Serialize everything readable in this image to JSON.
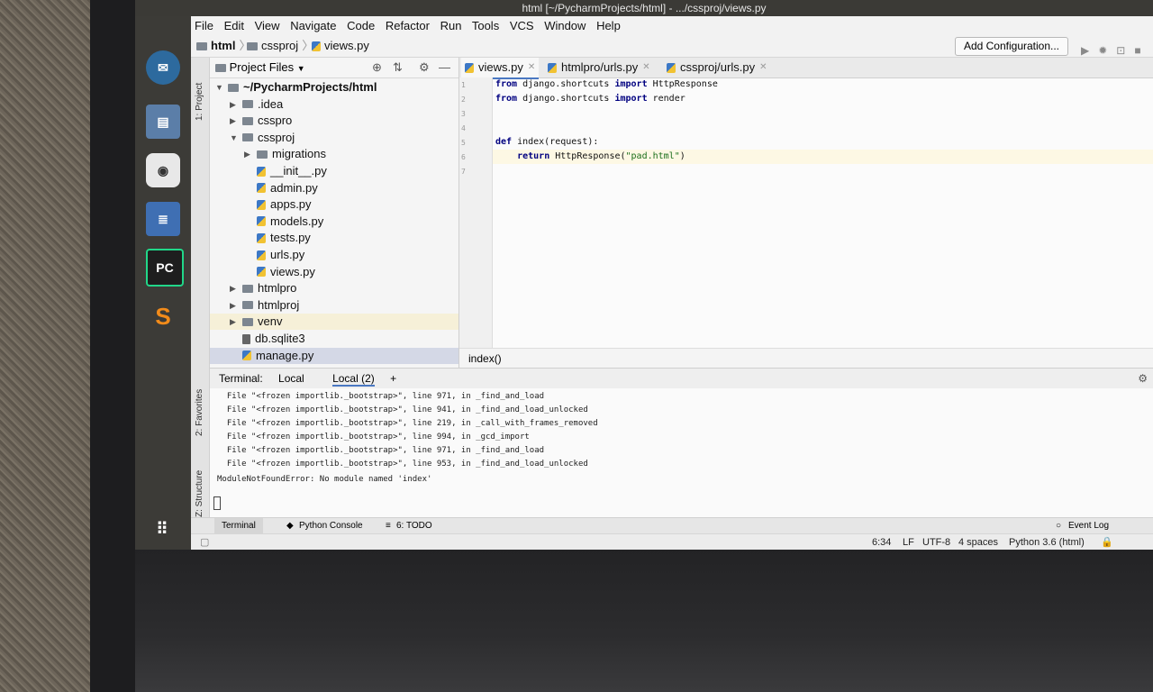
{
  "window": {
    "title": "html [~/PycharmProjects/html] - .../cssproj/views.py"
  },
  "menu": [
    "File",
    "Edit",
    "View",
    "Navigate",
    "Code",
    "Refactor",
    "Run",
    "Tools",
    "VCS",
    "Window",
    "Help"
  ],
  "breadcrumb": {
    "root": "html",
    "folder": "cssproj",
    "file": "views.py"
  },
  "toolbar": {
    "add_configuration": "Add Configuration..."
  },
  "side_tools": {
    "project": "1: Project",
    "favorites": "2: Favorites",
    "structure": "Z: Structure"
  },
  "project_panel": {
    "title": "Project Files",
    "tree": [
      {
        "label": "~/PycharmProjects/html",
        "kind": "folder",
        "depth": 0,
        "expanded": true
      },
      {
        "label": ".idea",
        "kind": "folder",
        "depth": 1,
        "expanded": false
      },
      {
        "label": "csspro",
        "kind": "folder",
        "depth": 1,
        "expanded": false
      },
      {
        "label": "cssproj",
        "kind": "folder",
        "depth": 1,
        "expanded": true
      },
      {
        "label": "migrations",
        "kind": "folder",
        "depth": 2,
        "expanded": false
      },
      {
        "label": "__init__.py",
        "kind": "file",
        "depth": 2
      },
      {
        "label": "admin.py",
        "kind": "file",
        "depth": 2
      },
      {
        "label": "apps.py",
        "kind": "file",
        "depth": 2
      },
      {
        "label": "models.py",
        "kind": "file",
        "depth": 2
      },
      {
        "label": "tests.py",
        "kind": "file",
        "depth": 2
      },
      {
        "label": "urls.py",
        "kind": "file",
        "depth": 2
      },
      {
        "label": "views.py",
        "kind": "file",
        "depth": 2
      },
      {
        "label": "htmlpro",
        "kind": "folder",
        "depth": 1,
        "expanded": false
      },
      {
        "label": "htmlproj",
        "kind": "folder",
        "depth": 1,
        "expanded": false
      },
      {
        "label": "venv",
        "kind": "folder",
        "depth": 1,
        "expanded": false
      },
      {
        "label": "db.sqlite3",
        "kind": "db",
        "depth": 1
      },
      {
        "label": "manage.py",
        "kind": "file",
        "depth": 1,
        "selected": true
      }
    ]
  },
  "editor": {
    "tabs": [
      {
        "label": "views.py",
        "active": true
      },
      {
        "label": "htmlpro/urls.py",
        "active": false
      },
      {
        "label": "cssproj/urls.py",
        "active": false
      }
    ],
    "line_numbers": [
      "1",
      "2",
      "3",
      "4",
      "5",
      "6",
      "7"
    ],
    "code": {
      "l1_kw": "from",
      "l1_mod": " django.shortcuts ",
      "l1_kw2": "import",
      "l1_name": " HttpResponse",
      "l2_kw": "from",
      "l2_mod": " django.shortcuts ",
      "l2_kw2": "import",
      "l2_name": " render",
      "l5_kw": "def",
      "l5_rest": " index(request):",
      "l6_kw": "return",
      "l6_call": " HttpResponse(",
      "l6_str": "\"pad.html\"",
      "l6_end": ")"
    },
    "footer_crumb": "index()"
  },
  "terminal": {
    "label": "Terminal:",
    "tabs": [
      "Local",
      "Local (2)"
    ],
    "add": "+",
    "lines": [
      "  File \"<frozen importlib._bootstrap>\", line 971, in _find_and_load",
      "  File \"<frozen importlib._bootstrap>\", line 941, in _find_and_load_unlocked",
      "  File \"<frozen importlib._bootstrap>\", line 219, in _call_with_frames_removed",
      "  File \"<frozen importlib._bootstrap>\", line 994, in _gcd_import",
      "  File \"<frozen importlib._bootstrap>\", line 971, in _find_and_load",
      "  File \"<frozen importlib._bootstrap>\", line 953, in _find_and_load_unlocked",
      "ModuleNotFoundError: No module named 'index'"
    ]
  },
  "bottom_tools": {
    "terminal": "Terminal",
    "python_console": "Python Console",
    "todo": "6: TODO",
    "event_log": "Event Log"
  },
  "status": {
    "position": "6:34",
    "line_sep": "LF",
    "encoding": "UTF-8",
    "indent": "4 spaces",
    "interpreter": "Python 3.6 (html)"
  }
}
